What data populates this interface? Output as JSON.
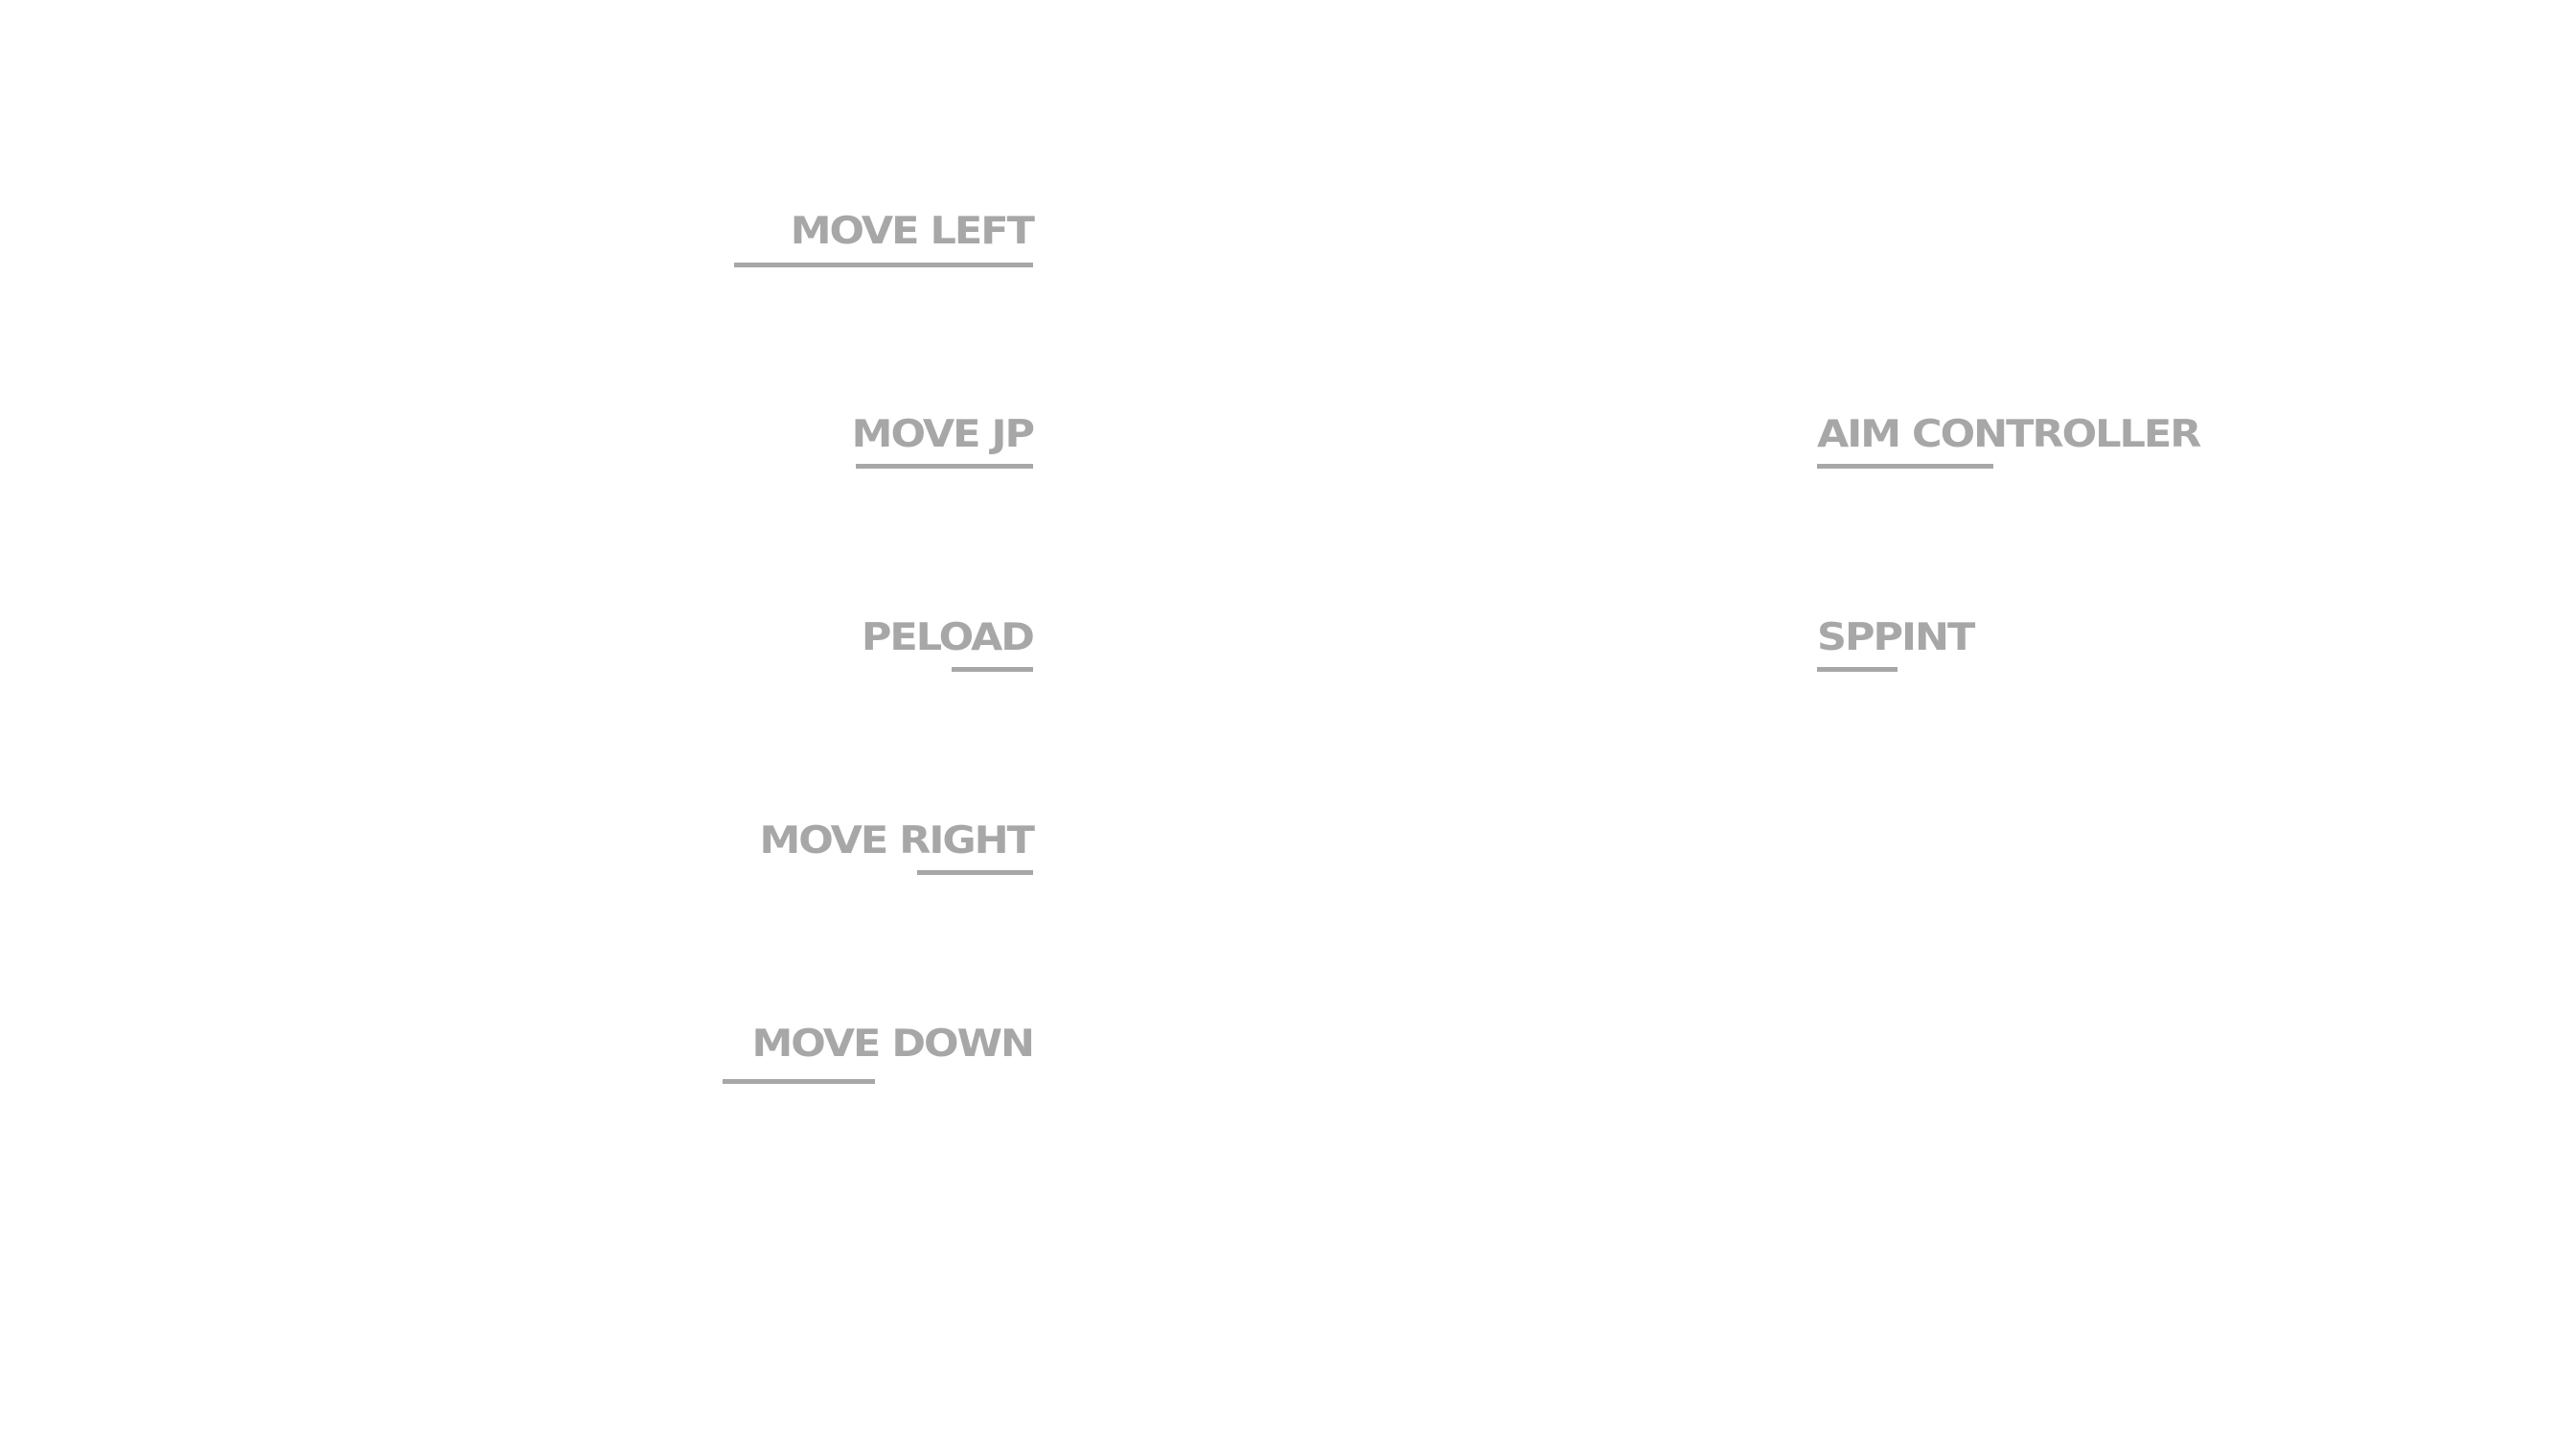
{
  "controls": {
    "move_left": "MOVE LEFT",
    "move_up": "MOVE JP",
    "reload": "PELOAD",
    "move_right": "MOVE RIGHT",
    "move_down": "MOVE DOWN",
    "aim_controller": "AIM CONTROLLER",
    "sprint": "SPPINT"
  },
  "colors": {
    "label": "#a7a7a7",
    "background": "#ffffff"
  }
}
